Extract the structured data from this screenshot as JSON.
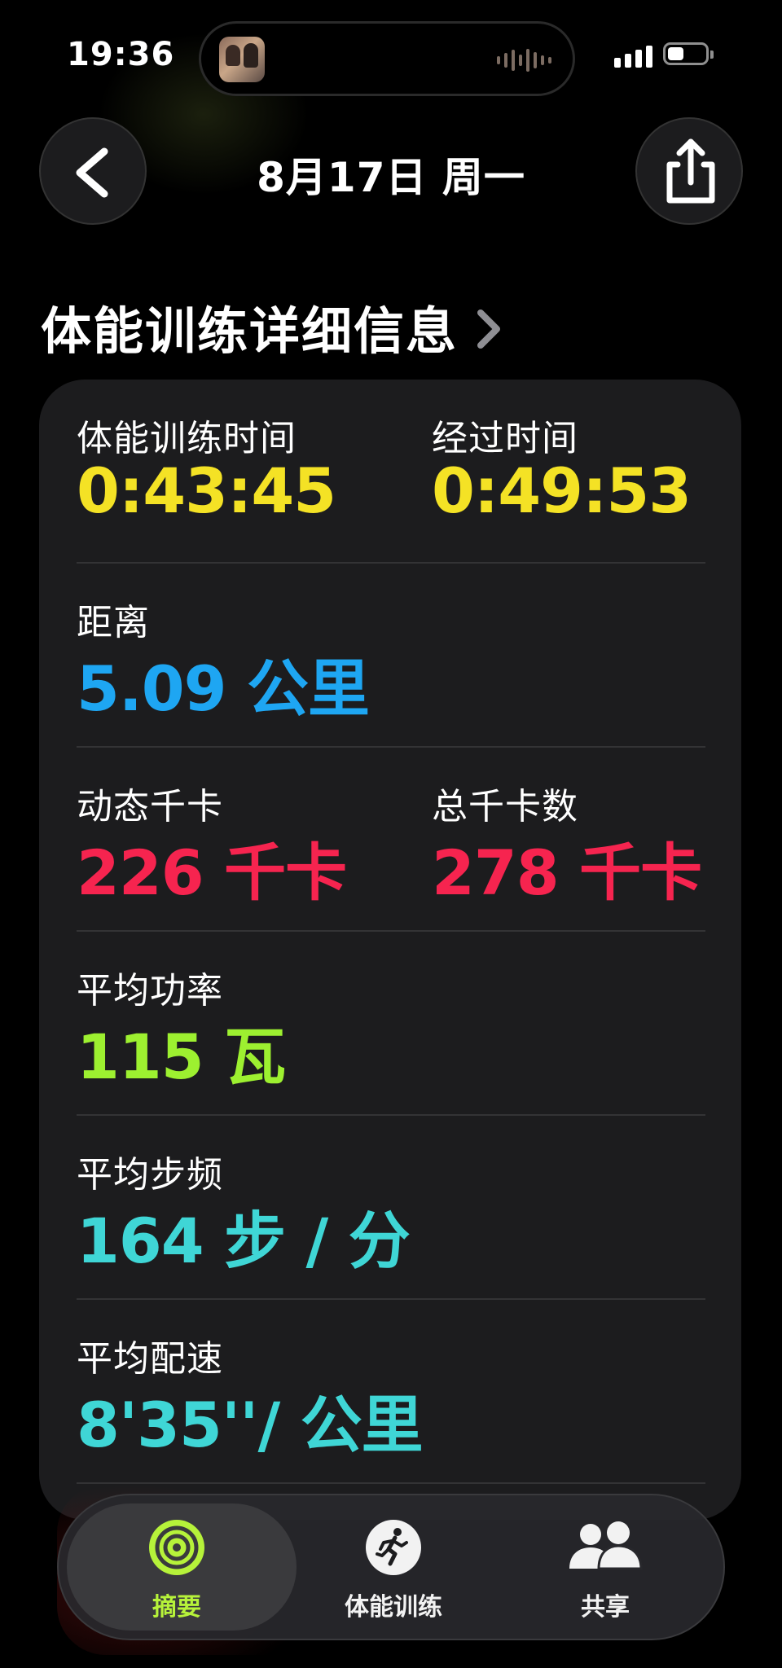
{
  "status_bar": {
    "time": "19:36",
    "icons": [
      "now-playing-art-icon",
      "audio-waveform-icon",
      "cellular-signal-icon",
      "battery-icon"
    ]
  },
  "nav": {
    "title": "8月17日 周一",
    "back_icon": "chevron-left-icon",
    "share_icon": "share-icon"
  },
  "section": {
    "title": "体能训练详细信息",
    "chevron_icon": "chevron-right-icon"
  },
  "metrics": {
    "workout_time": {
      "label": "体能训练时间",
      "value": "0:43:45"
    },
    "elapsed_time": {
      "label": "经过时间",
      "value": "0:49:53"
    },
    "distance": {
      "label": "距离",
      "value": "5.09 公里"
    },
    "active_calories": {
      "label": "动态千卡",
      "value": "226 千卡"
    },
    "total_calories": {
      "label": "总千卡数",
      "value": "278 千卡"
    },
    "avg_power": {
      "label": "平均功率",
      "value": "115 瓦"
    },
    "avg_cadence": {
      "label": "平均步频",
      "value": "164 步 / 分"
    },
    "avg_pace": {
      "label": "平均配速",
      "value": "8'35''/ 公里"
    }
  },
  "colors": {
    "time": "#f4e225",
    "distance": "#1ea6f2",
    "calories": "#f6244f",
    "power": "#9df030",
    "cadence_pace": "#3fd6d6",
    "active_tab": "#b6f23a"
  },
  "tabbar": {
    "tabs": [
      {
        "label": "摘要",
        "icon": "activity-rings-icon",
        "selected": true
      },
      {
        "label": "体能训练",
        "icon": "running-figure-icon",
        "selected": false
      },
      {
        "label": "共享",
        "icon": "people-icon",
        "selected": false
      }
    ]
  }
}
